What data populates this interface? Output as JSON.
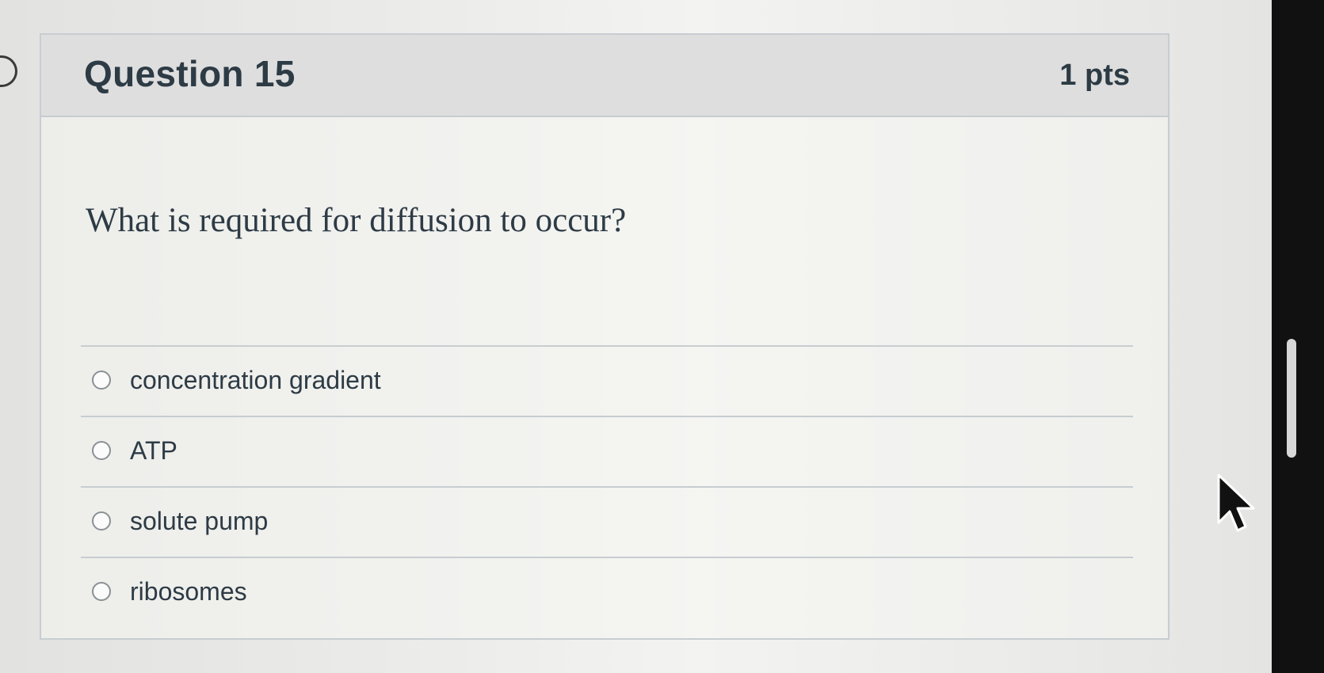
{
  "question": {
    "title": "Question 15",
    "points": "1 pts",
    "prompt": "What is required for diffusion to occur?",
    "answers": [
      {
        "label": "concentration gradient",
        "selected": false
      },
      {
        "label": "ATP",
        "selected": false
      },
      {
        "label": "solute pump",
        "selected": false
      },
      {
        "label": "ribosomes",
        "selected": false
      }
    ]
  },
  "icons": {
    "left_marker": "chevron-right-icon",
    "pointer": "mouse-pointer-icon"
  },
  "colors": {
    "text": "#2d3b45",
    "header_bg": "#dedede",
    "border": "#c7cdd1"
  }
}
